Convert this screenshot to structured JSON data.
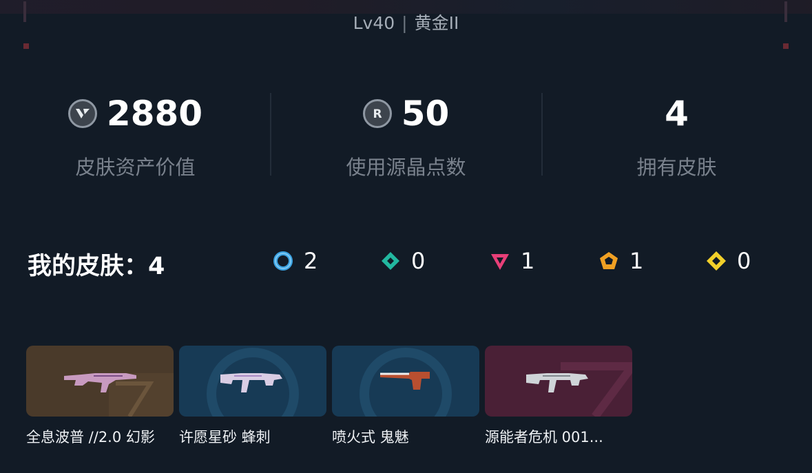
{
  "header": {
    "level": "Lv40",
    "separator": "|",
    "rank": "黄金II"
  },
  "stats": [
    {
      "icon": "valorant-point-icon",
      "value": "2880",
      "label": "皮肤资产价值"
    },
    {
      "icon": "radianite-point-icon",
      "value": "50",
      "label": "使用源晶点数"
    },
    {
      "icon": "",
      "value": "4",
      "label": "拥有皮肤"
    }
  ],
  "skins_summary": {
    "title": "我的皮肤：",
    "count": "4",
    "tiers": [
      {
        "icon": "select-tier-icon",
        "color": "#3aa1e0",
        "count": "2"
      },
      {
        "icon": "deluxe-tier-icon",
        "color": "#22b8a0",
        "count": "0"
      },
      {
        "icon": "premium-tier-icon",
        "color": "#e83f78",
        "count": "1"
      },
      {
        "icon": "exclusive-tier-icon",
        "color": "#f0a023",
        "count": "1"
      },
      {
        "icon": "ultra-tier-icon",
        "color": "#f2d02a",
        "count": "0"
      }
    ]
  },
  "skins": [
    {
      "name": "全息波普 //2.0 幻影",
      "bg": "#4a3a2a",
      "tier": "exclusive"
    },
    {
      "name": "许愿星砂 蜂刺",
      "bg": "#173a55",
      "tier": "select"
    },
    {
      "name": "喷火式 鬼魅",
      "bg": "#173a55",
      "tier": "select"
    },
    {
      "name": "源能者危机 001...",
      "bg": "#4a2036",
      "tier": "premium"
    }
  ],
  "colors": {
    "background": "#121b26",
    "text_primary": "#ffffff",
    "text_secondary": "#79818c"
  }
}
